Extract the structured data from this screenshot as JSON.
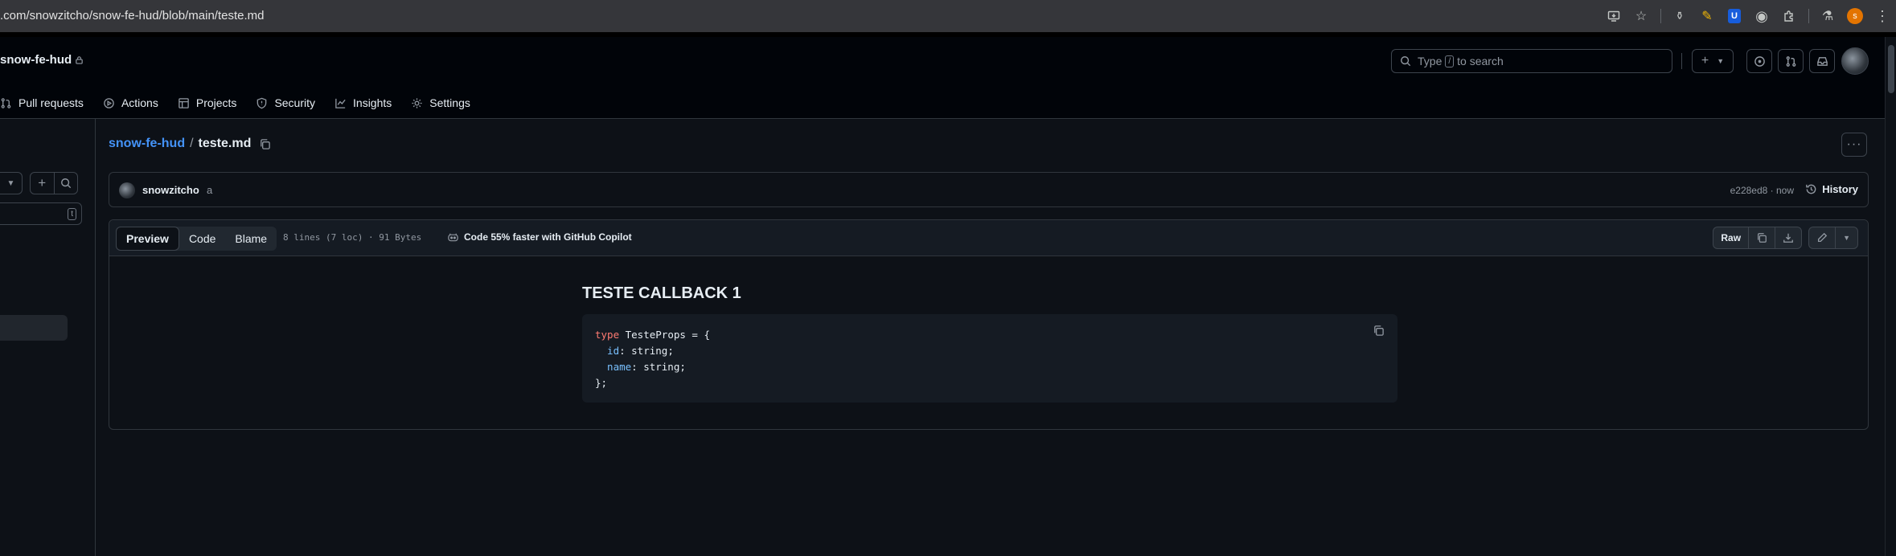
{
  "browser": {
    "url": ".com/snowzitcho/snow-fe-hud/blob/main/teste.md",
    "profile_initial": "s"
  },
  "header": {
    "repo_name": "snow-fe-hud",
    "search_placeholder_before": "Type",
    "search_key": "/",
    "search_placeholder_after": "to search"
  },
  "tabs": [
    {
      "label": "Pull requests",
      "icon": "pull-request-icon"
    },
    {
      "label": "Actions",
      "icon": "play-icon"
    },
    {
      "label": "Projects",
      "icon": "table-icon"
    },
    {
      "label": "Security",
      "icon": "shield-icon"
    },
    {
      "label": "Insights",
      "icon": "graph-icon"
    },
    {
      "label": "Settings",
      "icon": "gear-icon"
    }
  ],
  "sidebar": {
    "filter_key": "t"
  },
  "breadcrumb": {
    "repo": "snow-fe-hud",
    "separator": "/",
    "file": "teste.md"
  },
  "commit": {
    "author": "snowzitcho",
    "message": "a",
    "meta": "e228ed8 · now",
    "history_label": "History"
  },
  "file": {
    "view_tabs": [
      "Preview",
      "Code",
      "Blame"
    ],
    "info": "8 lines (7 loc) · 91 Bytes",
    "copilot_text": "Code 55% faster with GitHub Copilot",
    "raw_label": "Raw"
  },
  "markdown": {
    "heading": "TESTE CALLBACK 1",
    "code_lines": [
      {
        "kw": "type",
        "rest": " TesteProps = {"
      },
      {
        "prop": "  id",
        "rest": ": string;"
      },
      {
        "prop": "  name",
        "rest": ": string;"
      },
      {
        "rest": "};"
      }
    ]
  }
}
